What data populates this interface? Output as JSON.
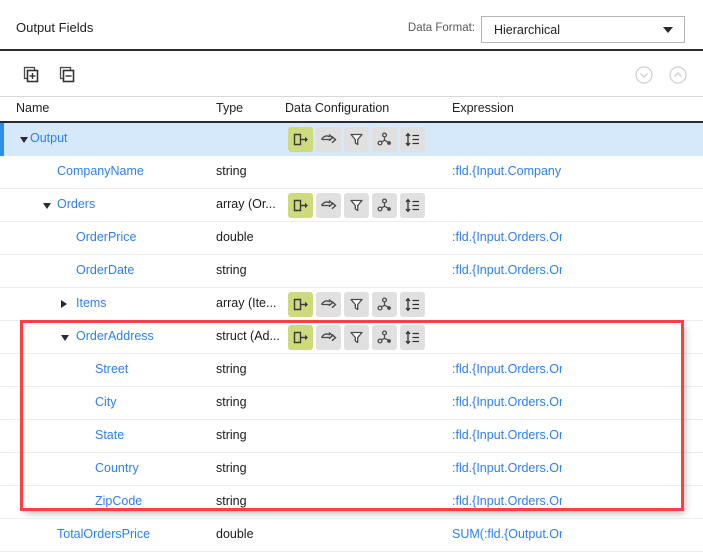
{
  "header": {
    "title": "Output Fields",
    "data_format_label": "Data Format:",
    "data_format_value": "Hierarchical",
    "caret_icon": "chevron-down-icon"
  },
  "toolbar": {
    "add_field_label": "add-field",
    "remove_field_label": "remove-field",
    "expand_all_label": "expand-all",
    "collapse_all_label": "collapse-all",
    "icons": [
      "copy-plus-icon",
      "copy-minus-icon",
      "circle-chevron-down-icon",
      "circle-chevron-up-icon"
    ]
  },
  "columns": {
    "name": "Name",
    "type": "Type",
    "data_configuration": "Data Configuration",
    "expression": "Expression"
  },
  "data_config_icons": [
    {
      "name": "output-arrow-icon",
      "state": "active",
      "color": "#cddb7c"
    },
    {
      "name": "pass-through-arrow-icon",
      "state": "inactive",
      "color": "#e0e0e0"
    },
    {
      "name": "filter-funnel-icon",
      "state": "inactive",
      "color": "#e0e0e0"
    },
    {
      "name": "group-by-icon",
      "state": "inactive",
      "color": "#e0e0e0"
    },
    {
      "name": "sort-order-icon",
      "state": "inactive",
      "color": "#e0e0e0"
    }
  ],
  "rows": [
    {
      "name": "Output",
      "type": "",
      "expression": "",
      "indent": 0,
      "twisty": "down",
      "selected": true,
      "has_config": true
    },
    {
      "name": "CompanyName",
      "type": "string",
      "expression": ":fld.{Input.CompanyNam",
      "indent": 1,
      "twisty": "none",
      "selected": false,
      "has_config": false
    },
    {
      "name": "Orders",
      "type": "array (Or...",
      "expression": "",
      "indent": 1,
      "twisty": "down",
      "selected": false,
      "has_config": true
    },
    {
      "name": "OrderPrice",
      "type": "double",
      "expression": ":fld.{Input.Orders.Order",
      "indent": 2,
      "twisty": "none",
      "selected": false,
      "has_config": false
    },
    {
      "name": "OrderDate",
      "type": "string",
      "expression": ":fld.{Input.Orders.Order",
      "indent": 2,
      "twisty": "none",
      "selected": false,
      "has_config": false
    },
    {
      "name": "Items",
      "type": "array (Ite...",
      "expression": "",
      "indent": 2,
      "twisty": "right",
      "selected": false,
      "has_config": true
    },
    {
      "name": "OrderAddress",
      "type": "struct (Ad...",
      "expression": "",
      "indent": 2,
      "twisty": "down",
      "selected": false,
      "has_config": true
    },
    {
      "name": "Street",
      "type": "string",
      "expression": ":fld.{Input.Orders.Order",
      "indent": 3,
      "twisty": "none",
      "selected": false,
      "has_config": false
    },
    {
      "name": "City",
      "type": "string",
      "expression": ":fld.{Input.Orders.Order",
      "indent": 3,
      "twisty": "none",
      "selected": false,
      "has_config": false
    },
    {
      "name": "State",
      "type": "string",
      "expression": ":fld.{Input.Orders.Order",
      "indent": 3,
      "twisty": "none",
      "selected": false,
      "has_config": false
    },
    {
      "name": "Country",
      "type": "string",
      "expression": ":fld.{Input.Orders.Order",
      "indent": 3,
      "twisty": "none",
      "selected": false,
      "has_config": false
    },
    {
      "name": "ZipCode",
      "type": "string",
      "expression": ":fld.{Input.Orders.Order",
      "indent": 3,
      "twisty": "none",
      "selected": false,
      "has_config": false
    },
    {
      "name": "TotalOrdersPrice",
      "type": "double",
      "expression": "SUM(:fld.{Output.Order",
      "indent": 1,
      "twisty": "none",
      "selected": false,
      "has_config": false
    }
  ],
  "annotation": {
    "highlight_color": "#fa4040",
    "covers_rows": [
      "OrderAddress",
      "Street",
      "City",
      "State",
      "Country",
      "ZipCode"
    ]
  },
  "colors": {
    "field_link": "#2d7ff0",
    "selected_row": "#d6e9fb",
    "selection_accent": "#2f8fe6",
    "icon_active": "#cddb7c",
    "icon_inactive": "#e0e0e0"
  }
}
